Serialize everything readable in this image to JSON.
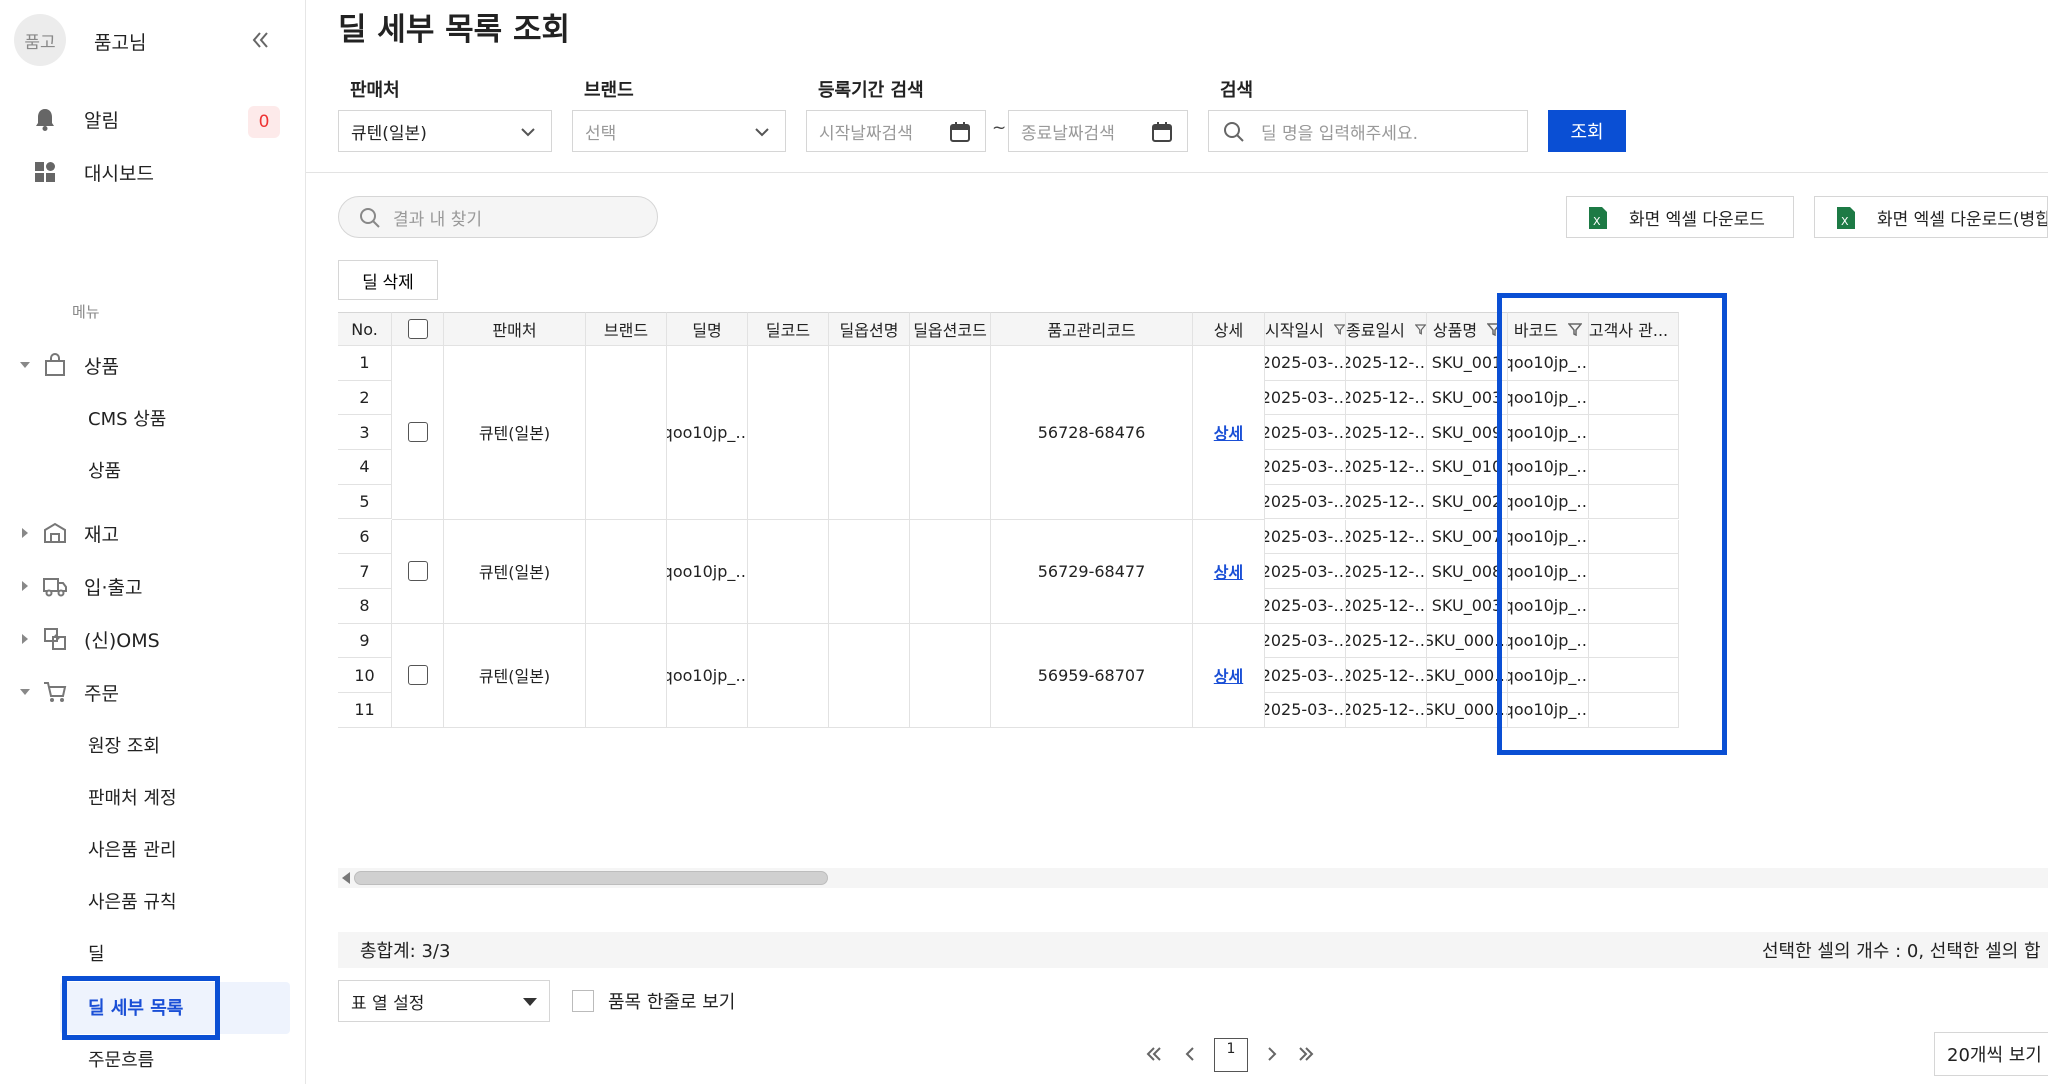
{
  "sidebar": {
    "avatar_text": "품고",
    "user_name": "품고님",
    "notifications_label": "알림",
    "notifications_count": "0",
    "dashboard_label": "대시보드",
    "menu_section_label": "메뉴",
    "tree": [
      {
        "label": "상품",
        "expanded": true,
        "icon": "shopping-bag-icon",
        "children": [
          "CMS 상품",
          "상품"
        ]
      },
      {
        "label": "재고",
        "expanded": false,
        "icon": "warehouse-icon",
        "children": []
      },
      {
        "label": "입·출고",
        "expanded": false,
        "icon": "truck-icon",
        "children": []
      },
      {
        "label": "(신)OMS",
        "expanded": false,
        "icon": "oms-icon",
        "children": []
      },
      {
        "label": "주문",
        "expanded": true,
        "icon": "cart-icon",
        "children": [
          "원장 조회",
          "판매처 계정",
          "사은품 관리",
          "사은품 규칙",
          "딜",
          "딜 세부 목록",
          "주문흐름"
        ]
      }
    ],
    "active_item": "딜 세부 목록"
  },
  "page": {
    "title": "딜 세부 목록 조회"
  },
  "filters": {
    "seller_label": "판매처",
    "seller_value": "큐텐(일본)",
    "brand_label": "브랜드",
    "brand_placeholder": "선택",
    "period_label": "등록기간 검색",
    "start_placeholder": "시작날짜검색",
    "end_placeholder": "종료날짜검색",
    "tilde": "~",
    "search_label": "검색",
    "search_placeholder": "딜 명을 입력해주세요.",
    "submit_label": "조회"
  },
  "toolbar": {
    "inner_search_placeholder": "결과 내 찾기",
    "excel_download": "화면 엑셀 다운로드",
    "excel_download_merged": "화면 엑셀 다운로드(병합)",
    "delete_deal": "딜 삭제"
  },
  "grid": {
    "headers": [
      "No.",
      "",
      "판매처",
      "브랜드",
      "딜명",
      "딜코드",
      "딜옵션명",
      "딜옵션코드",
      "품고관리코드",
      "상세",
      "시작일시",
      "종료일시",
      "상품명",
      "바코드",
      "고객사 관..."
    ],
    "groups": [
      {
        "seller": "큐텐(일본)",
        "deal_name": "qoo10jp_…",
        "manage_code": "56728-68476",
        "detail": "상세",
        "rows": [
          {
            "no": "1",
            "start": "2025-03-…",
            "end": "2025-12-…",
            "product": "SKU_001",
            "barcode": "qoo10jp_…"
          },
          {
            "no": "2",
            "start": "2025-03-…",
            "end": "2025-12-…",
            "product": "SKU_003",
            "barcode": "qoo10jp_…"
          },
          {
            "no": "3",
            "start": "2025-03-…",
            "end": "2025-12-…",
            "product": "SKU_009",
            "barcode": "qoo10jp_…"
          },
          {
            "no": "4",
            "start": "2025-03-…",
            "end": "2025-12-…",
            "product": "SKU_010",
            "barcode": "qoo10jp_…"
          },
          {
            "no": "5",
            "start": "2025-03-…",
            "end": "2025-12-…",
            "product": "SKU_002",
            "barcode": "qoo10jp_…"
          }
        ]
      },
      {
        "seller": "큐텐(일본)",
        "deal_name": "qoo10jp_…",
        "manage_code": "56729-68477",
        "detail": "상세",
        "rows": [
          {
            "no": "6",
            "start": "2025-03-…",
            "end": "2025-12-…",
            "product": "SKU_007",
            "barcode": "qoo10jp_…"
          },
          {
            "no": "7",
            "start": "2025-03-…",
            "end": "2025-12-…",
            "product": "SKU_008",
            "barcode": "qoo10jp_…"
          },
          {
            "no": "8",
            "start": "2025-03-…",
            "end": "2025-12-…",
            "product": "SKU_003",
            "barcode": "qoo10jp_…"
          }
        ]
      },
      {
        "seller": "큐텐(일본)",
        "deal_name": "qoo10jp_…",
        "manage_code": "56959-68707",
        "detail": "상세",
        "rows": [
          {
            "no": "9",
            "start": "2025-03-…",
            "end": "2025-12-…",
            "product": "SKU_000…",
            "barcode": "qoo10jp_…"
          },
          {
            "no": "10",
            "start": "2025-03-…",
            "end": "2025-12-…",
            "product": "SKU_000…",
            "barcode": "qoo10jp_…"
          },
          {
            "no": "11",
            "start": "2025-03-…",
            "end": "2025-12-…",
            "product": "SKU_000…",
            "barcode": "qoo10jp_…"
          }
        ]
      }
    ]
  },
  "summary": {
    "total": "총합계: 3/3",
    "selection": "선택한 셀의 개수 : 0, 선택한 셀의 합"
  },
  "footer": {
    "column_setting": "표 열 설정",
    "one_line_label": "품목 한줄로 보기",
    "current_page": "1",
    "per_page": "20개씩 보기"
  },
  "colors": {
    "accent": "#0a4fd4",
    "badge_bg": "#fdeaea",
    "badge_text": "#e33333",
    "excel_green": "#1d7a45"
  }
}
